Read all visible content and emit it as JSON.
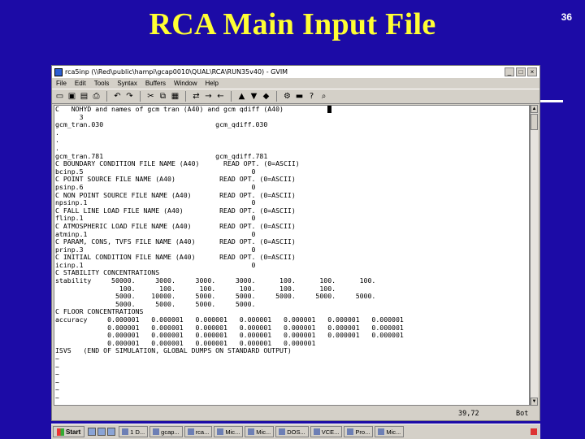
{
  "slide": {
    "title": "RCA Main Input File",
    "number": "36"
  },
  "window": {
    "title": "rca5inp (\\\\Red\\public\\hampi\\gcap0010\\QUAL\\RCA\\RUN35v40) - GVIM",
    "menu": [
      "File",
      "Edit",
      "Tools",
      "Syntax",
      "Buffers",
      "Window",
      "Help"
    ],
    "toolbar_icons": [
      "open-icon",
      "save-icon",
      "save-all-icon",
      "print-icon",
      "undo-icon",
      "redo-icon",
      "cut-icon",
      "copy-icon",
      "paste-icon",
      "replace-icon",
      "find-next-icon",
      "find-prev-icon",
      "load-session-icon",
      "save-session-icon",
      "run-script-icon",
      "make-icon",
      "shell-icon",
      "help-icon",
      "find-help-icon"
    ],
    "buttons": {
      "minimize": "_",
      "maximize": "□",
      "close": "×"
    }
  },
  "editor": {
    "lines": [
      "C   NOHYD and names of gcm tran (A40) and gcm qdiff (A40)",
      "      3",
      "gcm_tran.030                            gcm_qdiff.030",
      ".",
      ".",
      ".",
      "gcm_tran.781                            gcm_qdiff.781",
      "C BOUNDARY CONDITION FILE NAME (A40)      READ OPT. (0=ASCII)",
      "bcinp.5                                          0",
      "C POINT SOURCE FILE NAME (A40)           READ OPT. (0=ASCII)",
      "psinp.6                                          0",
      "C NON POINT SOURCE FILE NAME (A40)       READ OPT. (0=ASCII)",
      "npsinp.1                                         0",
      "C FALL LINE LOAD FILE NAME (A40)         READ OPT. (0=ASCII)",
      "flinp.1                                          0",
      "C ATMOSPHERIC LOAD FILE NAME (A40)       READ OPT. (0=ASCII)",
      "atminp.1                                         0",
      "C PARAM, CONS, TVFS FILE NAME (A40)      READ OPT. (0=ASCII)",
      "prinp.3                                          0",
      "C INITIAL CONDITION FILE NAME (A40)      READ OPT. (0=ASCII)",
      "icinp.1                                          0",
      "C STABILITY CONCENTRATIONS",
      "stability     50000.     3000.     3000.     3000.      100.      100.      100.",
      "                100.      100.      100.      100.      100.      100.",
      "               5000.    10000.     5000.     5000.     5000.     5000.     5000.",
      "               5000.     5000.     5000.     5000.",
      "C FLOOR CONCENTRATIONS",
      "accuracy     0.000001   0.000001   0.000001   0.000001   0.000001   0.000001   0.000001",
      "             0.000001   0.000001   0.000001   0.000001   0.000001   0.000001   0.000001",
      "             0.000001   0.000001   0.000001   0.000001   0.000001   0.000001   0.000001",
      "             0.000001   0.000001   0.000001   0.000001   0.000001",
      "ISVS   (END OF SIMULATION, GLOBAL DUMPS ON STANDARD OUTPUT)",
      "~",
      "~",
      "~",
      "~",
      "~",
      "~",
      "~"
    ]
  },
  "status": {
    "position": "39,72",
    "scroll": "Bot"
  },
  "taskbar": {
    "start_label": "Start",
    "tasks": [
      "1 D...",
      "gcap...",
      "rca...",
      "Mic...",
      "Mic...",
      "DOS...",
      "VCE...",
      "Pro...",
      "Mic..."
    ]
  }
}
